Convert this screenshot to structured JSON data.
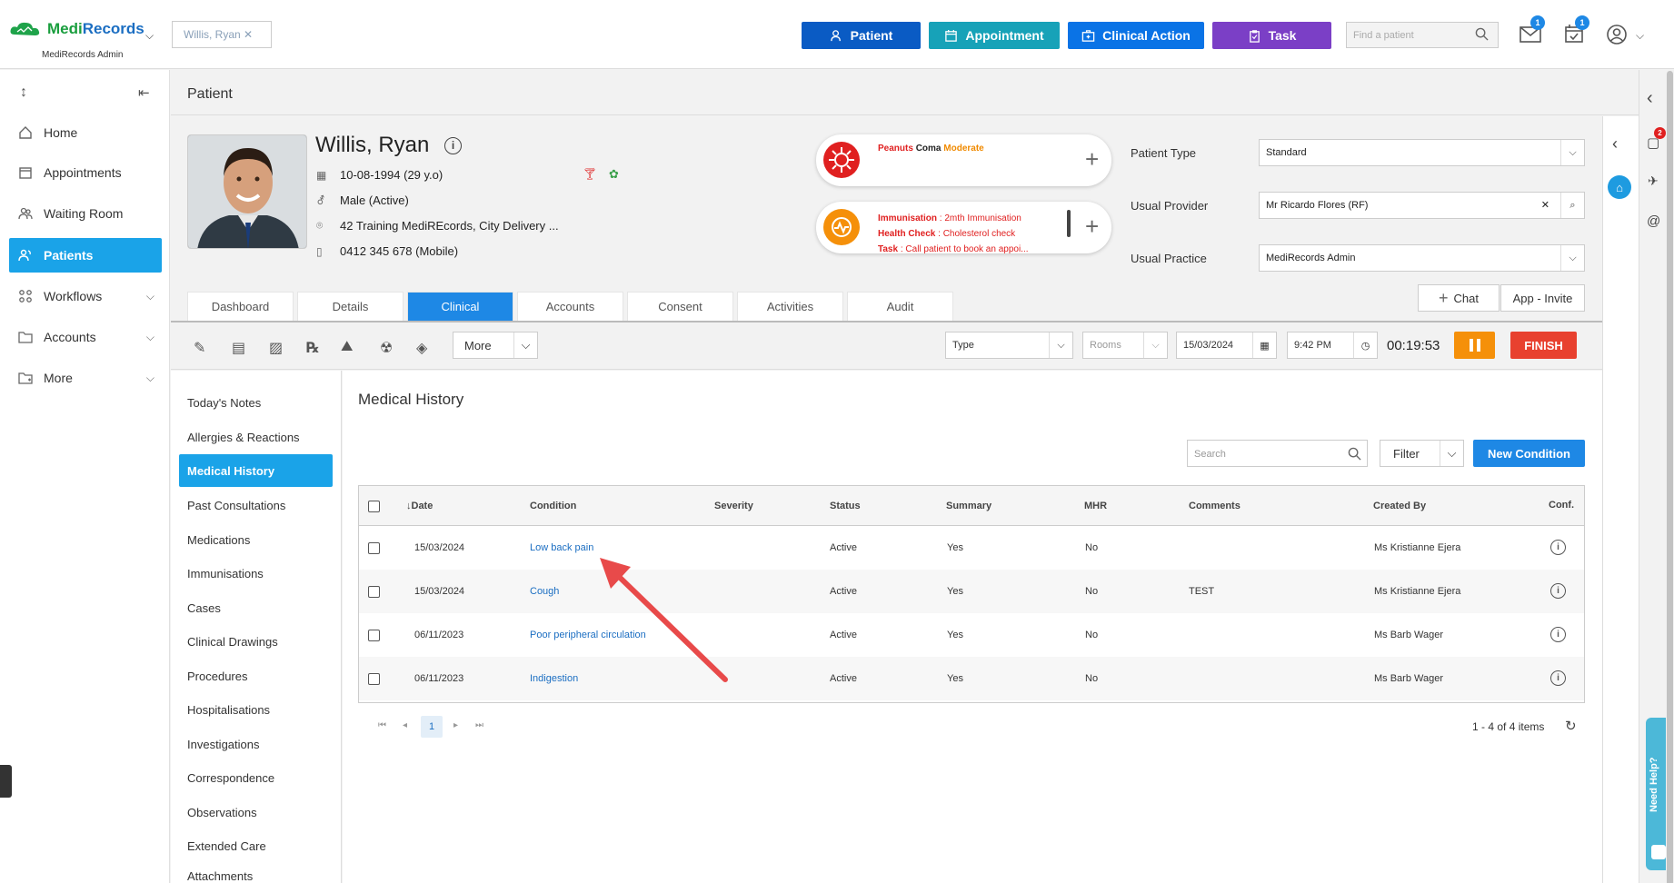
{
  "brand": {
    "name_part1": "Medi",
    "name_part2": "Records",
    "sub": "MediRecords Admin"
  },
  "topbar": {
    "patient_chip": "Willis, Ryan",
    "buttons": [
      {
        "label": "Patient",
        "color": "#0a5bc4",
        "icon": "user-add-icon"
      },
      {
        "label": "Appointment",
        "color": "#17a2b8",
        "icon": "calendar-icon"
      },
      {
        "label": "Clinical Action",
        "color": "#0a73e6",
        "icon": "medical-bag-icon"
      },
      {
        "label": "Task",
        "color": "#7b3fc6",
        "icon": "clipboard-icon"
      }
    ],
    "find_placeholder": "Find a patient",
    "mail_badge": "1",
    "calendar_badge": "1"
  },
  "sidebar": {
    "items": [
      {
        "label": "Home",
        "icon": "home-icon"
      },
      {
        "label": "Appointments",
        "icon": "calendar-icon"
      },
      {
        "label": "Waiting Room",
        "icon": "users-icon"
      },
      {
        "label": "Patients",
        "icon": "user-icon",
        "active": true
      },
      {
        "label": "Workflows",
        "icon": "workflow-icon"
      },
      {
        "label": "Accounts",
        "icon": "folder-icon"
      },
      {
        "label": "More",
        "icon": "more-icon"
      }
    ]
  },
  "page": {
    "title": "Patient"
  },
  "patient": {
    "name": "Willis, Ryan",
    "dob": "10-08-1994 (29 y.o)",
    "gender": "Male (Active)",
    "address": "42 Training MediREcords, City Delivery ...",
    "phone": "0412 345 678 (Mobile)"
  },
  "alerts": {
    "allergy": {
      "substance": "Peanuts",
      "reaction": "Coma",
      "severity": "Moderate"
    },
    "reminders": [
      {
        "type": "Immunisation",
        "text": "2mth Immunisation"
      },
      {
        "type": "Health Check",
        "text": "Cholesterol check"
      },
      {
        "type": "Task",
        "text": "Call patient to book an appoi..."
      }
    ]
  },
  "fields": {
    "patient_type_label": "Patient Type",
    "patient_type": "Standard",
    "usual_provider_label": "Usual Provider",
    "usual_provider": "Mr Ricardo Flores (RF)",
    "usual_practice_label": "Usual Practice",
    "usual_practice": "MediRecords Admin"
  },
  "actions": {
    "chat": "Chat",
    "app_invite": "App - Invite"
  },
  "tabs": [
    "Dashboard",
    "Details",
    "Clinical",
    "Accounts",
    "Consent",
    "Activities",
    "Audit"
  ],
  "active_tab": "Clinical",
  "toolbar": {
    "more": "More",
    "type_placeholder": "Type",
    "rooms_placeholder": "Rooms",
    "date": "15/03/2024",
    "time": "9:42 PM",
    "timer": "00:19:53",
    "finish": "FINISH"
  },
  "subnav": [
    "Today's Notes",
    "Allergies & Reactions",
    "Medical History",
    "Past Consultations",
    "Medications",
    "Immunisations",
    "Cases",
    "Clinical Drawings",
    "Procedures",
    "Hospitalisations",
    "Investigations",
    "Correspondence",
    "Observations",
    "Extended Care",
    "Attachments"
  ],
  "content": {
    "title": "Medical History",
    "search_placeholder": "Search",
    "filter": "Filter",
    "new_condition": "New Condition",
    "columns": [
      "Date",
      "Condition",
      "Severity",
      "Status",
      "Summary",
      "MHR",
      "Comments",
      "Created By",
      "Conf."
    ],
    "rows": [
      {
        "date": "15/03/2024",
        "condition": "Low back pain",
        "severity": "",
        "status": "Active",
        "summary": "Yes",
        "mhr": "No",
        "comments": "",
        "created_by": "Ms Kristianne Ejera"
      },
      {
        "date": "15/03/2024",
        "condition": "Cough",
        "severity": "",
        "status": "Active",
        "summary": "Yes",
        "mhr": "No",
        "comments": "TEST",
        "created_by": "Ms Kristianne Ejera"
      },
      {
        "date": "06/11/2023",
        "condition": "Poor peripheral circulation",
        "severity": "",
        "status": "Active",
        "summary": "Yes",
        "mhr": "No",
        "comments": "",
        "created_by": "Ms Barb Wager"
      },
      {
        "date": "06/11/2023",
        "condition": "Indigestion",
        "severity": "",
        "status": "Active",
        "summary": "Yes",
        "mhr": "No",
        "comments": "",
        "created_by": "Ms Barb Wager"
      }
    ],
    "page": "1",
    "pager_summary": "1 - 4 of 4 items"
  },
  "rail": {
    "notif_badge": "2",
    "need_help": "Need Help?"
  }
}
